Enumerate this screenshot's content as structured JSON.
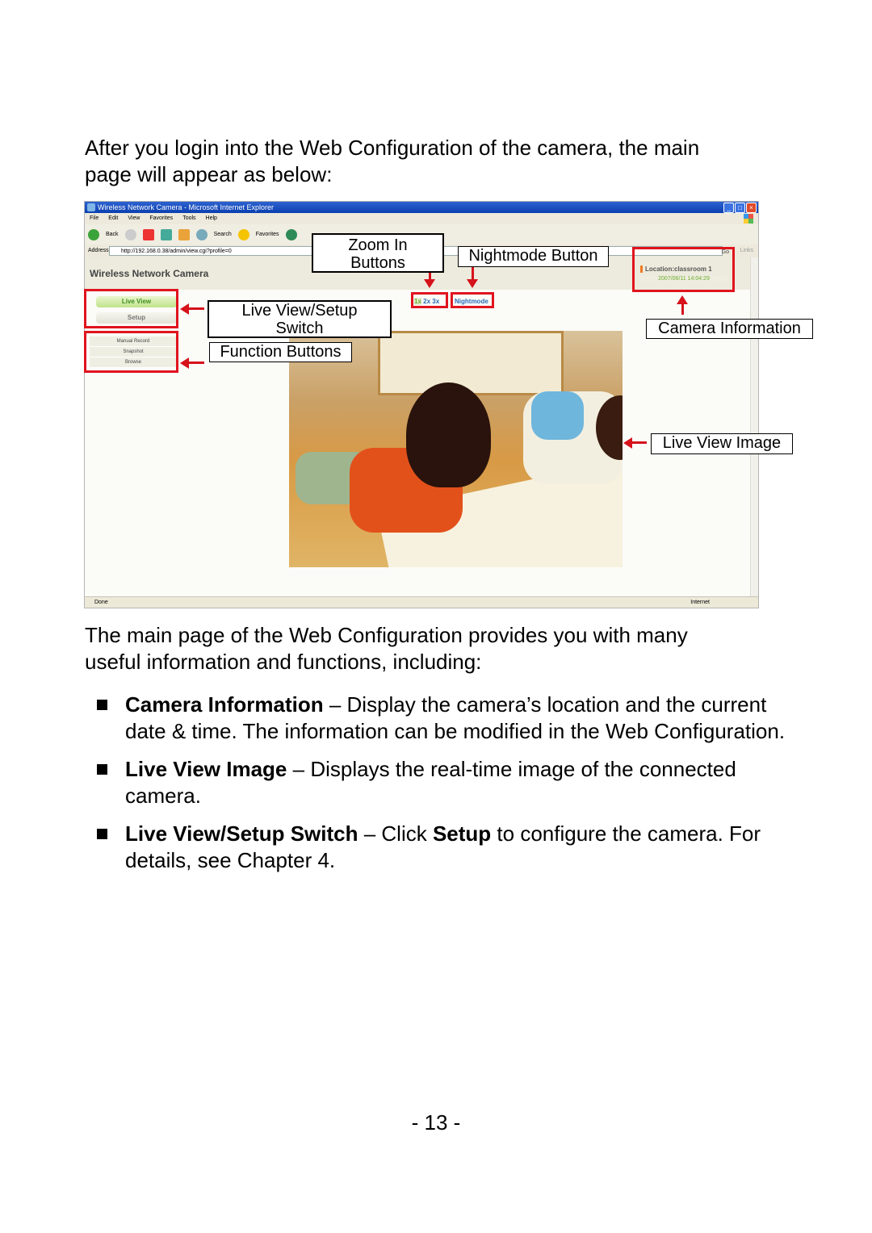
{
  "intro": {
    "line1": "After you login into the Web Configuration of the camera, the main",
    "line2": "page will appear as below:"
  },
  "browser": {
    "window_title": "Wireless Network Camera - Microsoft Internet Explorer",
    "menu": [
      "File",
      "Edit",
      "View",
      "Favorites",
      "Tools",
      "Help"
    ],
    "toolbar": {
      "back": "Back",
      "search": "Search",
      "favorites": "Favorites",
      "media": "Media"
    },
    "address_label": "Address",
    "url": "http://192.168.0.38/admin/view.cgi?profile=0",
    "go_label": "Go",
    "links_label": "Links",
    "status_text": "Done",
    "zone_text": "Internet"
  },
  "camera_page": {
    "header_title": "Wireless Network Camera",
    "live_view_label": "Live View",
    "setup_label": "Setup",
    "function_buttons": [
      "Manual Record",
      "Snapshot",
      "Browse"
    ],
    "zoom_buttons": [
      "1x",
      "2x",
      "3x"
    ],
    "nightmode_label": "Nightmode",
    "location": "Location:classroom 1",
    "datetime": "2007/06/11 14:04:29",
    "live_image_description": "Two children drawing on paper on a classroom floor"
  },
  "callouts": {
    "zoom_in": "Zoom In Buttons",
    "zoom_in_line1": "Zoom In",
    "zoom_in_line2": "Buttons",
    "nightmode": "Nightmode Button",
    "switch_line1": "Live View/Setup",
    "switch_line2": "Switch",
    "function": "Function Buttons",
    "camera_info": "Camera Information",
    "live_view_image": "Live View Image"
  },
  "main_desc": {
    "line1": "The main page of the Web Configuration provides you with many",
    "line2": "useful information and functions, including:"
  },
  "bullets": [
    {
      "term": "Camera Information",
      "text": " – Display the camera’s location and the current date & time. The information can be modified in the Web Configuration."
    },
    {
      "term": "Live View Image",
      "text": " – Displays the real-time image of the connected camera."
    },
    {
      "term": "Live View/Setup Switch",
      "text_pre": " – Click ",
      "strong": "Setup",
      "text_post": " to configure the camera. For details, see Chapter 4."
    }
  ],
  "page_number": "- 13 -",
  "colors": {
    "highlight": "#e0141e",
    "accent_green": "#6cae2e",
    "link_blue": "#2a6cb8"
  }
}
